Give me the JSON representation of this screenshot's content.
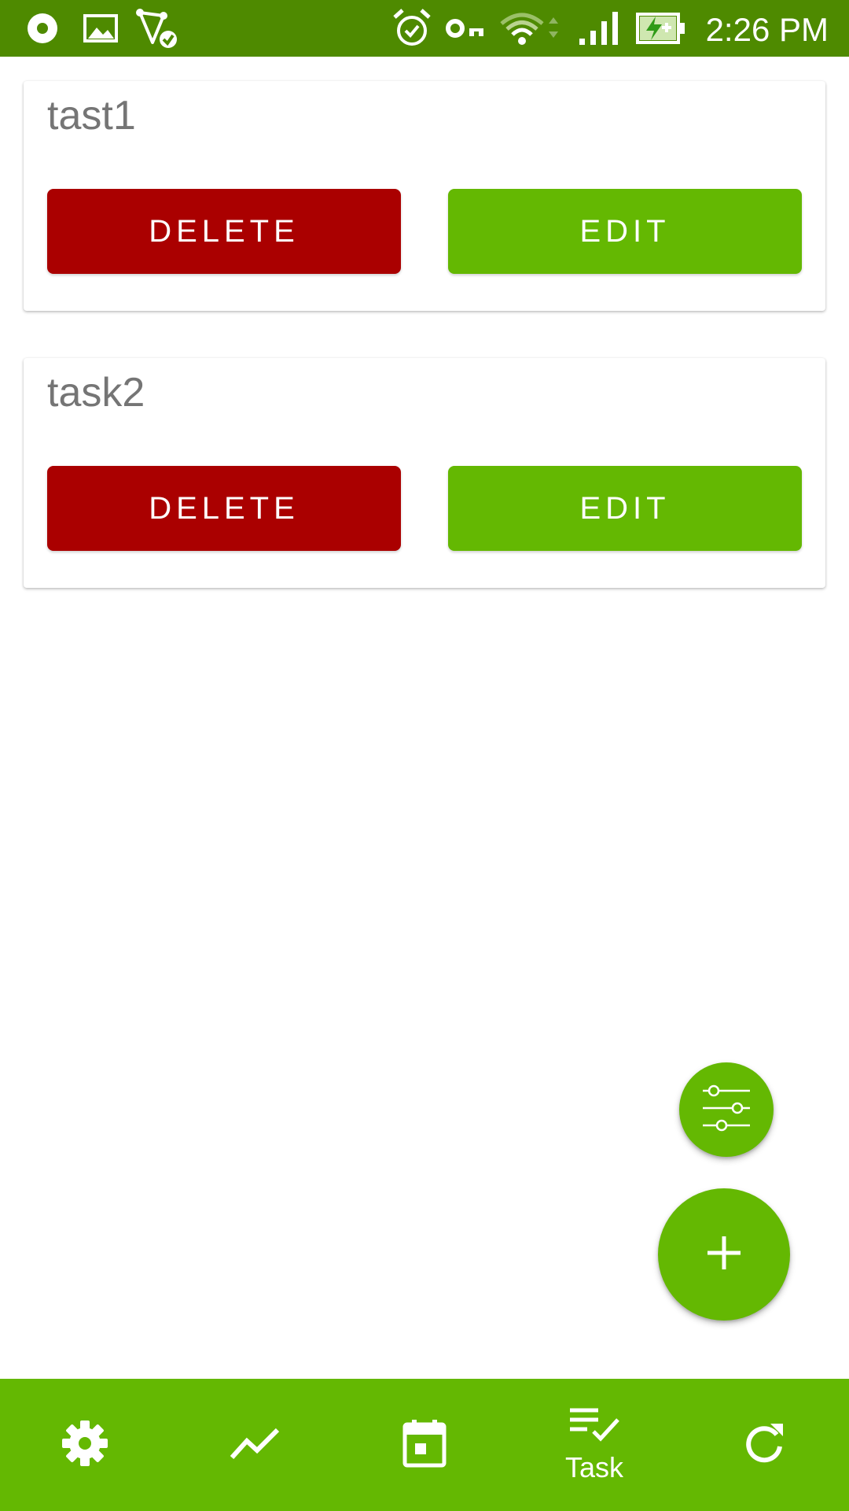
{
  "status_bar": {
    "time": "2:26 PM",
    "background_color": "#4e8a00",
    "left_icons": [
      "media-disc-icon",
      "image-icon",
      "location-check-icon"
    ],
    "right_icons": [
      "alarm-icon",
      "vpn-key-icon",
      "wifi-icon",
      "signal-icon",
      "battery-charging-icon"
    ]
  },
  "tasks": [
    {
      "title": "tast1",
      "delete_label": "DELETE",
      "edit_label": "EDIT"
    },
    {
      "title": "task2",
      "delete_label": "DELETE",
      "edit_label": "EDIT"
    }
  ],
  "fabs": {
    "filter_icon": "tune-sliders-icon",
    "add_icon": "plus-icon"
  },
  "bottom_nav": {
    "items": [
      {
        "icon": "gear-icon",
        "label": ""
      },
      {
        "icon": "trend-chart-icon",
        "label": ""
      },
      {
        "icon": "calendar-icon",
        "label": ""
      },
      {
        "icon": "task-check-icon",
        "label": "Task",
        "active": true
      },
      {
        "icon": "refresh-icon",
        "label": ""
      }
    ]
  },
  "colors": {
    "accent_green": "#64b802",
    "status_green": "#4e8a00",
    "delete_red": "#aa0000",
    "title_gray": "#757575"
  }
}
